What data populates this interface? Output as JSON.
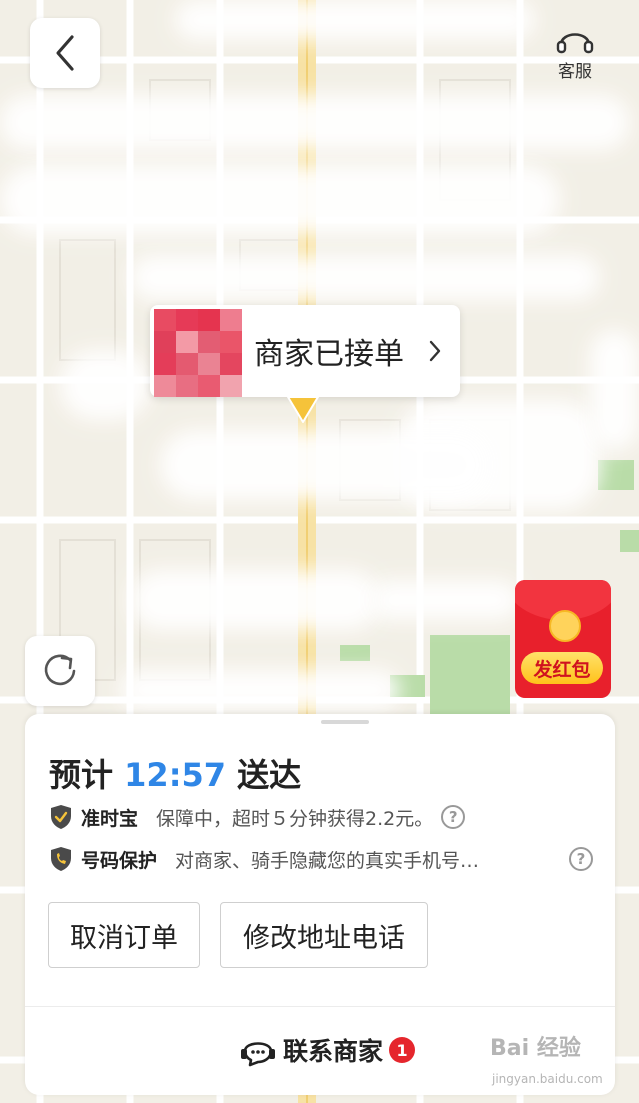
{
  "map": {
    "colors": {
      "land": "#f2efe6",
      "road": "#ffffff",
      "main_road": "#f7e2a5",
      "park": "#b9dca8"
    }
  },
  "header": {
    "back_icon": "chevron-left-icon",
    "customer_service": {
      "icon": "headset-icon",
      "label": "客服"
    }
  },
  "merchant_card": {
    "status": "商家已接单",
    "chevron_icon": "chevron-right-icon"
  },
  "red_packet": {
    "label": "发红包",
    "color": "#e8202c"
  },
  "order": {
    "eta_prefix": "预计",
    "eta_time": "12:57",
    "eta_suffix": "送达",
    "eta_color": "#2f86e6",
    "ontime": {
      "icon": "shield-check-icon",
      "title": "准时宝",
      "desc": "保障中，超时５分钟获得2.2元。"
    },
    "privacy": {
      "icon": "phone-shield-icon",
      "title": "号码保护",
      "desc": "对商家、骑手隐藏您的真实手机号…"
    },
    "help_glyph": "?",
    "buttons": {
      "cancel": "取消订单",
      "modify": "修改地址电话"
    },
    "contact": {
      "icon": "chat-bubble-icon",
      "label": "联系商家",
      "badge": "1"
    }
  },
  "watermark": {
    "logo": "Bai 经验",
    "url": "jingyan.baidu.com"
  }
}
